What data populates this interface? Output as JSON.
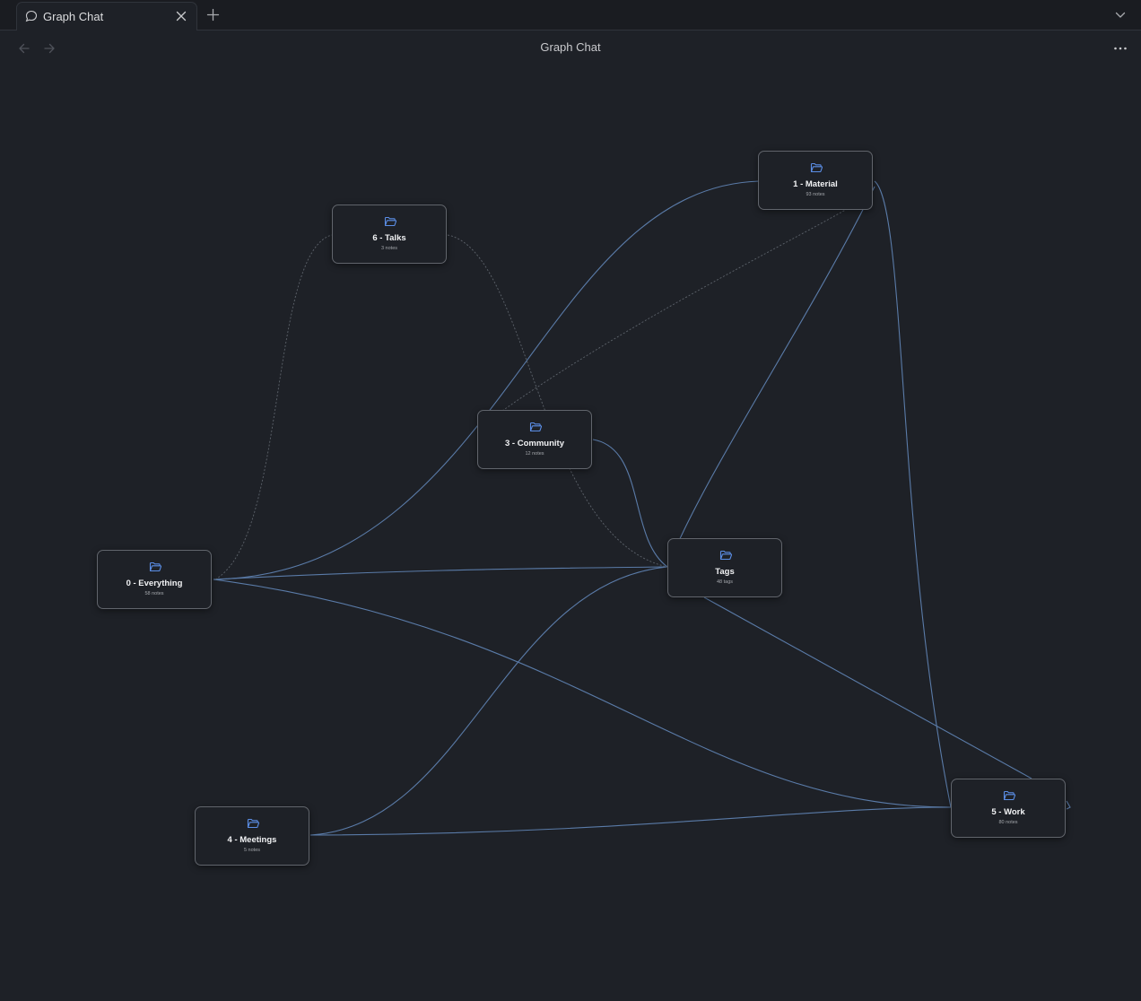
{
  "tab": {
    "title": "Graph Chat"
  },
  "header": {
    "title": "Graph Chat"
  },
  "icons": {
    "tab": "chat-bubble-icon",
    "close": "close-icon",
    "new_tab": "plus-icon",
    "tab_list": "chevron-down-icon",
    "back": "arrow-left-icon",
    "forward": "arrow-right-icon",
    "more": "more-horizontal-icon",
    "node": "folder-open-icon"
  },
  "colors": {
    "background": "#1e2127",
    "edge": "#5a7ba8",
    "folder_icon": "#5b8ee6",
    "node_border": "#61656c"
  },
  "nodes": [
    {
      "id": "material",
      "title": "1 - Material",
      "subtitle": "93 notes"
    },
    {
      "id": "talks",
      "title": "6 - Talks",
      "subtitle": "3 notes"
    },
    {
      "id": "community",
      "title": "3 - Community",
      "subtitle": "12 notes"
    },
    {
      "id": "tags",
      "title": "Tags",
      "subtitle": "48 tags"
    },
    {
      "id": "everything",
      "title": "0 - Everything",
      "subtitle": "58 notes"
    },
    {
      "id": "meetings",
      "title": "4 - Meetings",
      "subtitle": "5 notes"
    },
    {
      "id": "work",
      "title": "5 - Work",
      "subtitle": "80 notes"
    }
  ]
}
